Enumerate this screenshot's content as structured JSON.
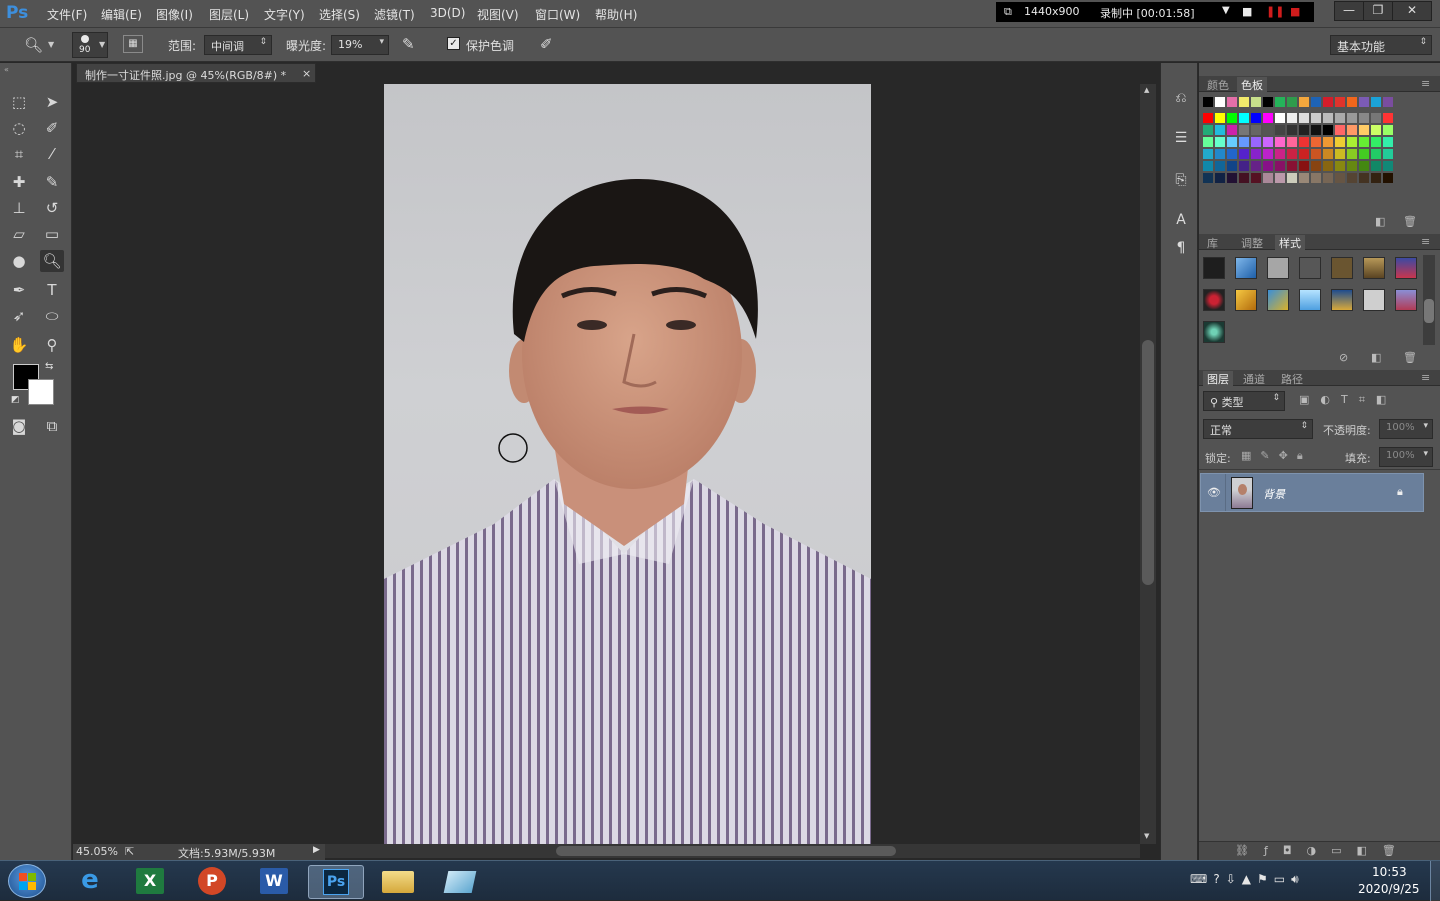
{
  "app": {
    "logo": "Ps",
    "menu": [
      "文件(F)",
      "编辑(E)",
      "图像(I)",
      "图层(L)",
      "文字(Y)",
      "选择(S)",
      "滤镜(T)",
      "3D(D)",
      "视图(V)",
      "窗口(W)",
      "帮助(H)"
    ],
    "recorder": {
      "resolution": "1440x900",
      "status": "录制中 [00:01:58]"
    },
    "window_controls": [
      "minimize-icon",
      "restore-icon",
      "close-icon"
    ]
  },
  "options_bar": {
    "brush_size": "90",
    "range_label": "范围:",
    "range_value": "中间调",
    "exposure_label": "曝光度:",
    "exposure_value": "19%",
    "protect_tones_label": "保护色调",
    "protect_tones_checked": true,
    "workspace": "基本功能"
  },
  "document": {
    "tab_title": "制作一寸证件照.jpg @ 45%(RGB/8#) *",
    "zoom": "45.05%",
    "doc_info": "文档:5.93M/5.93M"
  },
  "panels": {
    "color_tabs": [
      "颜色",
      "色板"
    ],
    "color_active": "色板",
    "style_tabs": [
      "库",
      "调整",
      "样式"
    ],
    "style_active": "样式",
    "layer_tabs": [
      "图层",
      "通道",
      "路径"
    ],
    "layer_active": "图层",
    "filter_kind": "类型",
    "blend_mode": "正常",
    "opacity_label": "不透明度:",
    "opacity_value": "100%",
    "lock_label": "锁定:",
    "fill_label": "填充:",
    "fill_value": "100%",
    "layers": [
      {
        "name": "背景",
        "visible": true,
        "locked": true
      }
    ]
  },
  "taskbar": {
    "apps": [
      "start-orb",
      "internet-explorer",
      "excel",
      "powerpoint",
      "word",
      "photoshop",
      "file-explorer",
      "notes"
    ],
    "active_app": "photoshop",
    "time": "10:53",
    "date": "2020/9/25"
  },
  "colors": {
    "ui_dark": "#535353",
    "canvas": "#282828",
    "selected_layer": "#6a7f9b"
  }
}
